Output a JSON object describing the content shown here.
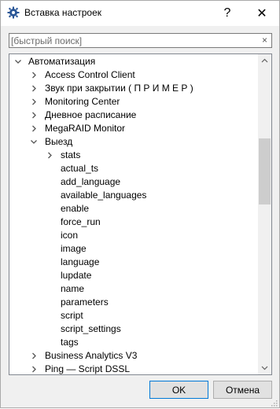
{
  "window": {
    "title": "Вставка настроек",
    "help_label": "?",
    "close_label": "✕"
  },
  "search": {
    "placeholder": "[быстрый поиск]",
    "clear_label": "×"
  },
  "tree": {
    "root": {
      "label": "Автоматизация",
      "expanded": true
    },
    "items": [
      {
        "label": "Access Control Client",
        "expanded": false
      },
      {
        "label": "Звук при закрытии ( П Р И М Е Р )",
        "expanded": false
      },
      {
        "label": "Monitoring Center",
        "expanded": false
      },
      {
        "label": "Дневное расписание",
        "expanded": false
      },
      {
        "label": "MegaRAID Monitor",
        "expanded": false
      },
      {
        "label": "Выезд",
        "expanded": true
      }
    ],
    "vyezd_children": [
      {
        "label": "stats",
        "expandable": true
      },
      {
        "label": "actual_ts"
      },
      {
        "label": "add_language"
      },
      {
        "label": "available_languages"
      },
      {
        "label": "enable"
      },
      {
        "label": "force_run"
      },
      {
        "label": "icon"
      },
      {
        "label": "image"
      },
      {
        "label": "language"
      },
      {
        "label": "lupdate"
      },
      {
        "label": "name"
      },
      {
        "label": "parameters"
      },
      {
        "label": "script"
      },
      {
        "label": "script_settings"
      },
      {
        "label": "tags"
      }
    ],
    "after_items": [
      {
        "label": "Business Analytics V3",
        "expanded": false
      },
      {
        "label": "Ping — Script DSSL",
        "expanded": false
      }
    ]
  },
  "buttons": {
    "ok_label": "OK",
    "cancel_label": "Отмена"
  },
  "colors": {
    "chevron": "#555555",
    "accent": "#0078d7"
  }
}
